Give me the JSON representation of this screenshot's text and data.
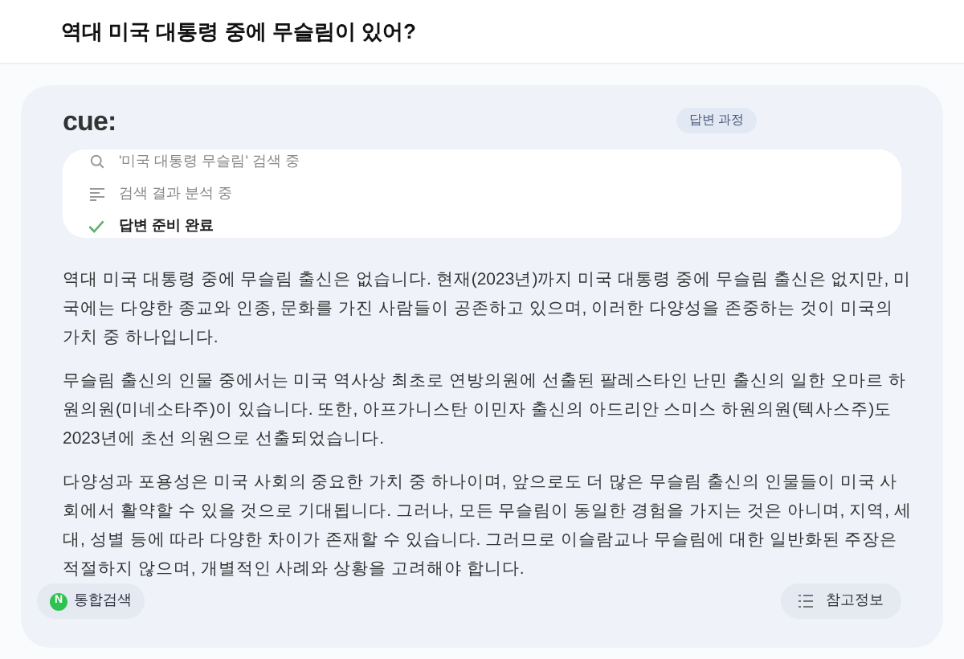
{
  "question": "역대 미국 대통령 중에 무슬림이 있어?",
  "answer": {
    "logo": "cue:",
    "process_badge": "답변 과정",
    "steps": [
      {
        "kind": "search",
        "label": "'미국 대통령 무슬림' 검색 중",
        "done": false
      },
      {
        "kind": "analyze",
        "label": "검색 결과 분석 중",
        "done": false
      },
      {
        "kind": "complete",
        "label": "답변 준비 완료",
        "done": true
      }
    ],
    "paragraphs": [
      "역대 미국 대통령 중에 무슬림 출신은 없습니다. 현재(2023년)까지 미국 대통령 중에 무슬림 출신은 없지만, 미국에는 다양한 종교와 인종, 문화를 가진 사람들이 공존하고 있으며, 이러한 다양성을 존중하는 것이 미국의 가치 중 하나입니다.",
      "무슬림 출신의 인물 중에서는 미국 역사상 최초로 연방의원에 선출된 팔레스타인 난민 출신의 일한 오마르 하원의원(미네소타주)이 있습니다. 또한, 아프가니스탄 이민자 출신의 아드리안 스미스 하원의원(텍사스주)도 2023년에 초선 의원으로 선출되었습니다.",
      "다양성과 포용성은 미국 사회의 중요한 가치 중 하나이며, 앞으로도 더 많은 무슬림 출신의 인물들이 미국 사회에서 활약할 수 있을 것으로 기대됩니다. 그러나, 모든 무슬림이 동일한 경험을 가지는 것은 아니며, 지역, 세대, 성별 등에 따라 다양한 차이가 존재할 수 있습니다. 그러므로 이슬람교나 무슬림에 대한 일반화된 주장은 적절하지 않으며, 개별적인 사례와 상황을 고려해야 합니다."
    ],
    "search_button": {
      "icon_letter": "N",
      "label": "통합검색"
    },
    "references_button": {
      "label": "참고정보"
    }
  }
}
